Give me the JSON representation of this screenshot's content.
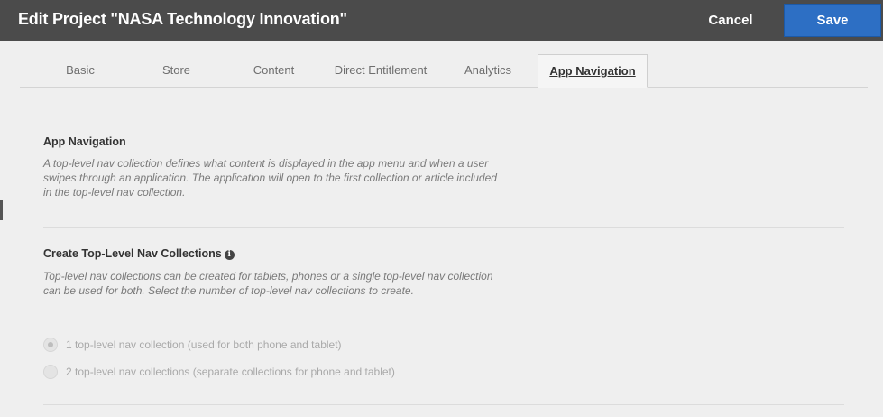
{
  "header": {
    "title": "Edit Project \"NASA Technology Innovation\"",
    "cancel_label": "Cancel",
    "save_label": "Save"
  },
  "tabs": [
    {
      "label": "Basic",
      "active": false
    },
    {
      "label": "Store",
      "active": false
    },
    {
      "label": "Content",
      "active": false
    },
    {
      "label": "Direct Entitlement",
      "active": false
    },
    {
      "label": "Analytics",
      "active": false
    },
    {
      "label": "App Navigation",
      "active": true
    }
  ],
  "app_navigation": {
    "title": "App Navigation",
    "description": "A top-level nav collection defines what content is displayed in the app menu and when a user swipes through an application. The application will open to the first collection or article included in the top-level nav collection."
  },
  "top_level_nav": {
    "title": "Create Top-Level Nav Collections",
    "info_icon_glyph": "i",
    "description": "Top-level nav collections can be created for tablets, phones or a single top-level nav collection can be used for both. Select the number of top-level nav collections to create.",
    "options": [
      {
        "label": "1 top-level nav collection (used for both phone and tablet)",
        "checked": true,
        "disabled": true
      },
      {
        "label": "2 top-level nav collections (separate collections for phone and tablet)",
        "checked": false,
        "disabled": true
      }
    ]
  },
  "colors": {
    "header_bg": "#4b4b4b",
    "save_button": "#2d6fc4",
    "panel_bg": "#efefef"
  }
}
